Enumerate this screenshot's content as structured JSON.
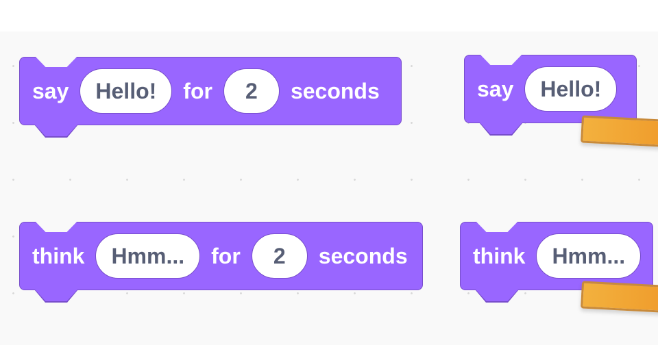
{
  "blocks": [
    {
      "verb": "say",
      "message": "Hello!",
      "connector": "for",
      "duration": "2",
      "unit": "seconds"
    },
    {
      "verb": "say",
      "message": "Hello!"
    },
    {
      "verb": "think",
      "message": "Hmm...",
      "connector": "for",
      "duration": "2",
      "unit": "seconds"
    },
    {
      "verb": "think",
      "message": "Hmm..."
    }
  ],
  "colors": {
    "block_fill": "#9966ff",
    "block_border": "#774dcb",
    "input_text": "#575e75",
    "highlight_bar": "#ef9a2a",
    "workspace_bg": "#f9f9f9"
  }
}
